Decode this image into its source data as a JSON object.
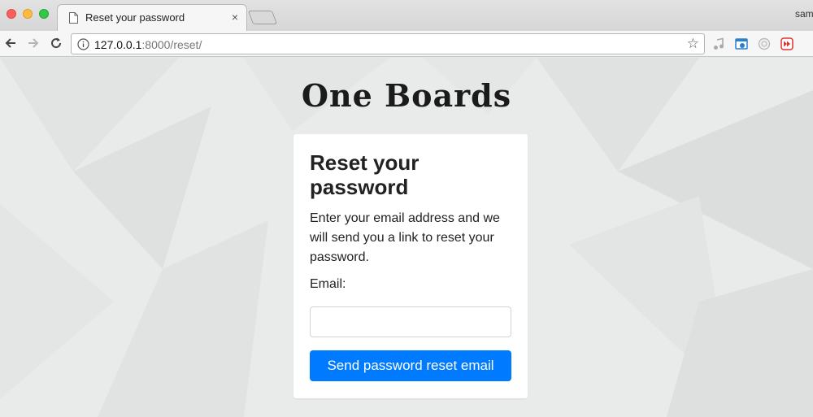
{
  "browser": {
    "tab_title": "Reset your password",
    "tab_close": "×",
    "profile_name": "sam",
    "url_host": "127.0.0.1",
    "url_rest": ":8000/reset/",
    "bookmark_icon": "star-icon"
  },
  "page": {
    "brand": "One Boards",
    "card": {
      "title": "Reset your password",
      "description": "Enter your email address and we will send you a link to reset your password.",
      "email_label": "Email:",
      "email_value": "",
      "submit_label": "Send password reset email"
    }
  },
  "colors": {
    "primary_button": "#007bff",
    "background": "#e9eaea"
  }
}
